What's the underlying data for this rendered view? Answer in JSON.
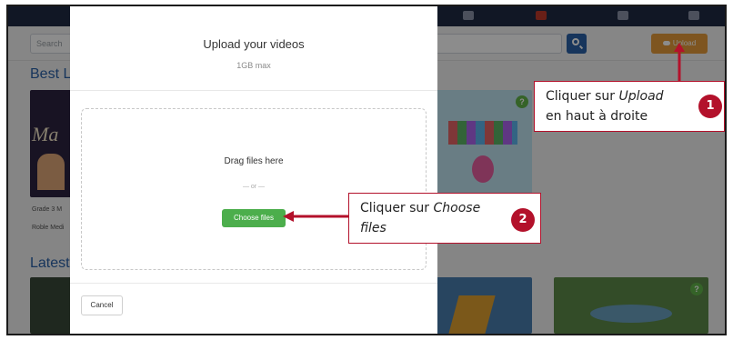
{
  "app": {
    "search_placeholder": "Search",
    "upload_label": "Upload",
    "section_best": "Best L",
    "section_latest": "Latest",
    "thumb_caption_1": "Grade 3 M",
    "thumb_caption_2": "Roble Medi",
    "badge_mark": "?"
  },
  "modal": {
    "title": "Upload your videos",
    "subtitle": "1GB max",
    "drag_text": "Drag files here",
    "or_text": "— or —",
    "choose_label": "Choose files",
    "cancel_label": "Cancel"
  },
  "callouts": [
    {
      "number": "1",
      "line1_plain": "Cliquer sur ",
      "line1_italic": "Upload",
      "line2": "en haut à droite"
    },
    {
      "number": "2",
      "line1_plain": "Cliquer sur ",
      "line1_italic": "Choose",
      "line2_italic": "files"
    }
  ],
  "colors": {
    "accent_red": "#b3112b",
    "upload_orange": "#e59c3b",
    "choose_green": "#4cae4c",
    "link_blue": "#2b62a8"
  }
}
